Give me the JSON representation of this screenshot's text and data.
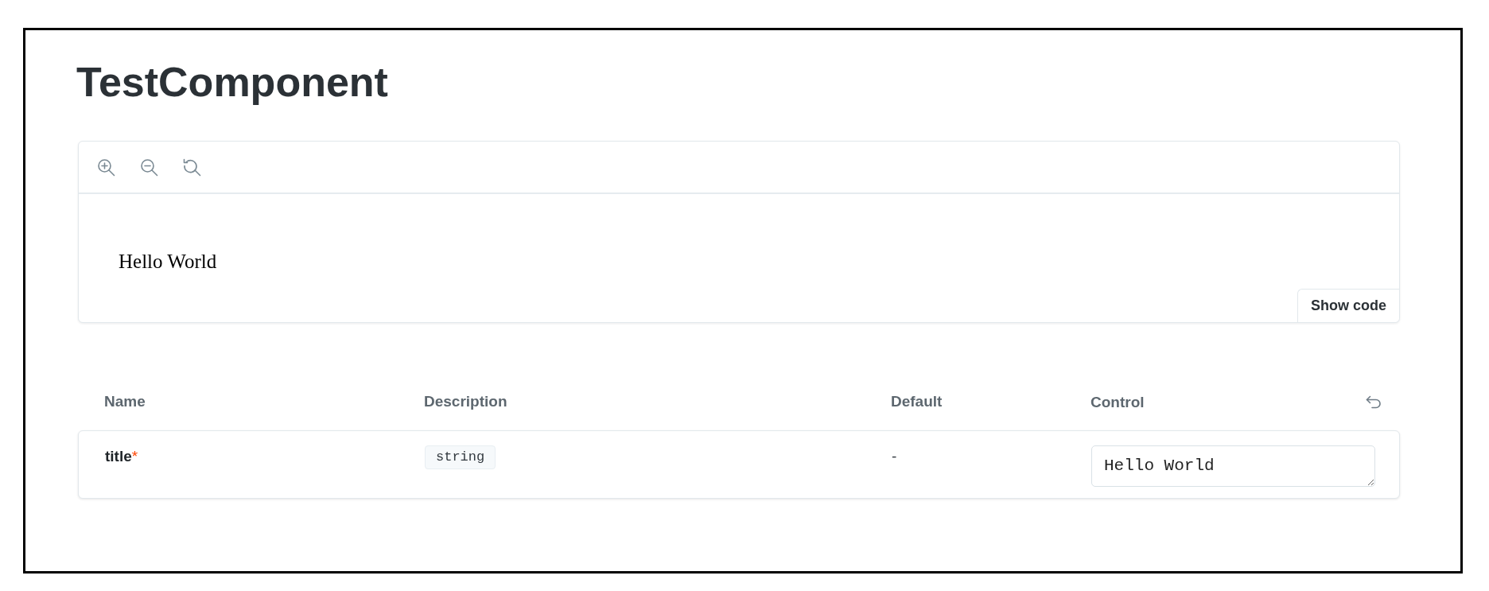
{
  "page": {
    "title": "TestComponent"
  },
  "preview": {
    "content": "Hello World",
    "show_code_button": "Show code"
  },
  "props_table": {
    "columns": [
      {
        "label": "Name"
      },
      {
        "label": "Description"
      },
      {
        "label": "Default"
      },
      {
        "label": "Control"
      }
    ],
    "rows": [
      {
        "name": "title",
        "required_mark": "*",
        "type": "string",
        "default": "-",
        "control": {
          "kind": "text",
          "value": "Hello World"
        }
      }
    ]
  }
}
